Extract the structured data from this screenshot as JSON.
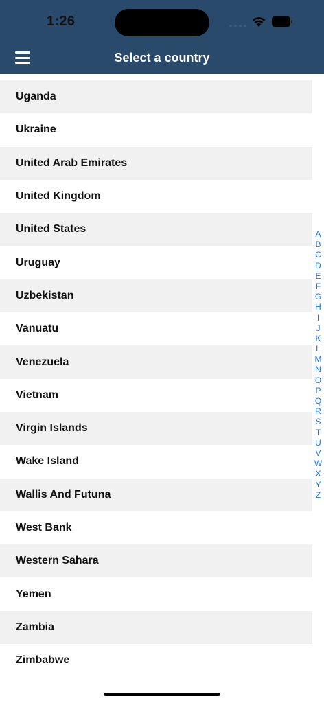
{
  "status_bar": {
    "time": "1:26"
  },
  "header": {
    "title": "Select a country",
    "menu_icon": "hamburger-icon",
    "background": "#2a4a6b"
  },
  "countries": [
    "Uganda",
    "Ukraine",
    "United Arab Emirates",
    "United Kingdom",
    "United States",
    "Uruguay",
    "Uzbekistan",
    "Vanuatu",
    "Venezuela",
    "Vietnam",
    "Virgin Islands",
    "Wake Island",
    "Wallis And Futuna",
    "West Bank",
    "Western Sahara",
    "Yemen",
    "Zambia",
    "Zimbabwe"
  ],
  "index_letters": [
    "A",
    "B",
    "C",
    "D",
    "E",
    "F",
    "G",
    "H",
    "I",
    "J",
    "K",
    "L",
    "M",
    "N",
    "O",
    "P",
    "Q",
    "R",
    "S",
    "T",
    "U",
    "V",
    "W",
    "X",
    "Y",
    "Z"
  ],
  "colors": {
    "index_accent": "#1a73e8",
    "row_alt": "#f1f1f1"
  }
}
